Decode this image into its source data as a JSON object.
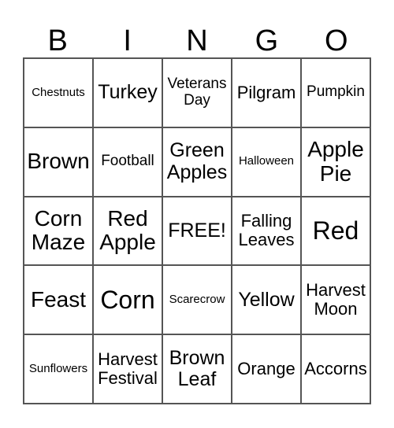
{
  "header": [
    "B",
    "I",
    "N",
    "G",
    "O"
  ],
  "cells": [
    [
      "Chestnuts",
      "Turkey",
      "Veterans Day",
      "Pilgram",
      "Pumpkin"
    ],
    [
      "Brown",
      "Football",
      "Green Apples",
      "Halloween",
      "Apple Pie"
    ],
    [
      "Corn Maze",
      "Red Apple",
      "FREE!",
      "Falling Leaves",
      "Red"
    ],
    [
      "Feast",
      "Corn",
      "Scarecrow",
      "Yellow",
      "Harvest Moon"
    ],
    [
      "Sunflowers",
      "Harvest Festival",
      "Brown Leaf",
      "Orange",
      "Accorns"
    ]
  ]
}
